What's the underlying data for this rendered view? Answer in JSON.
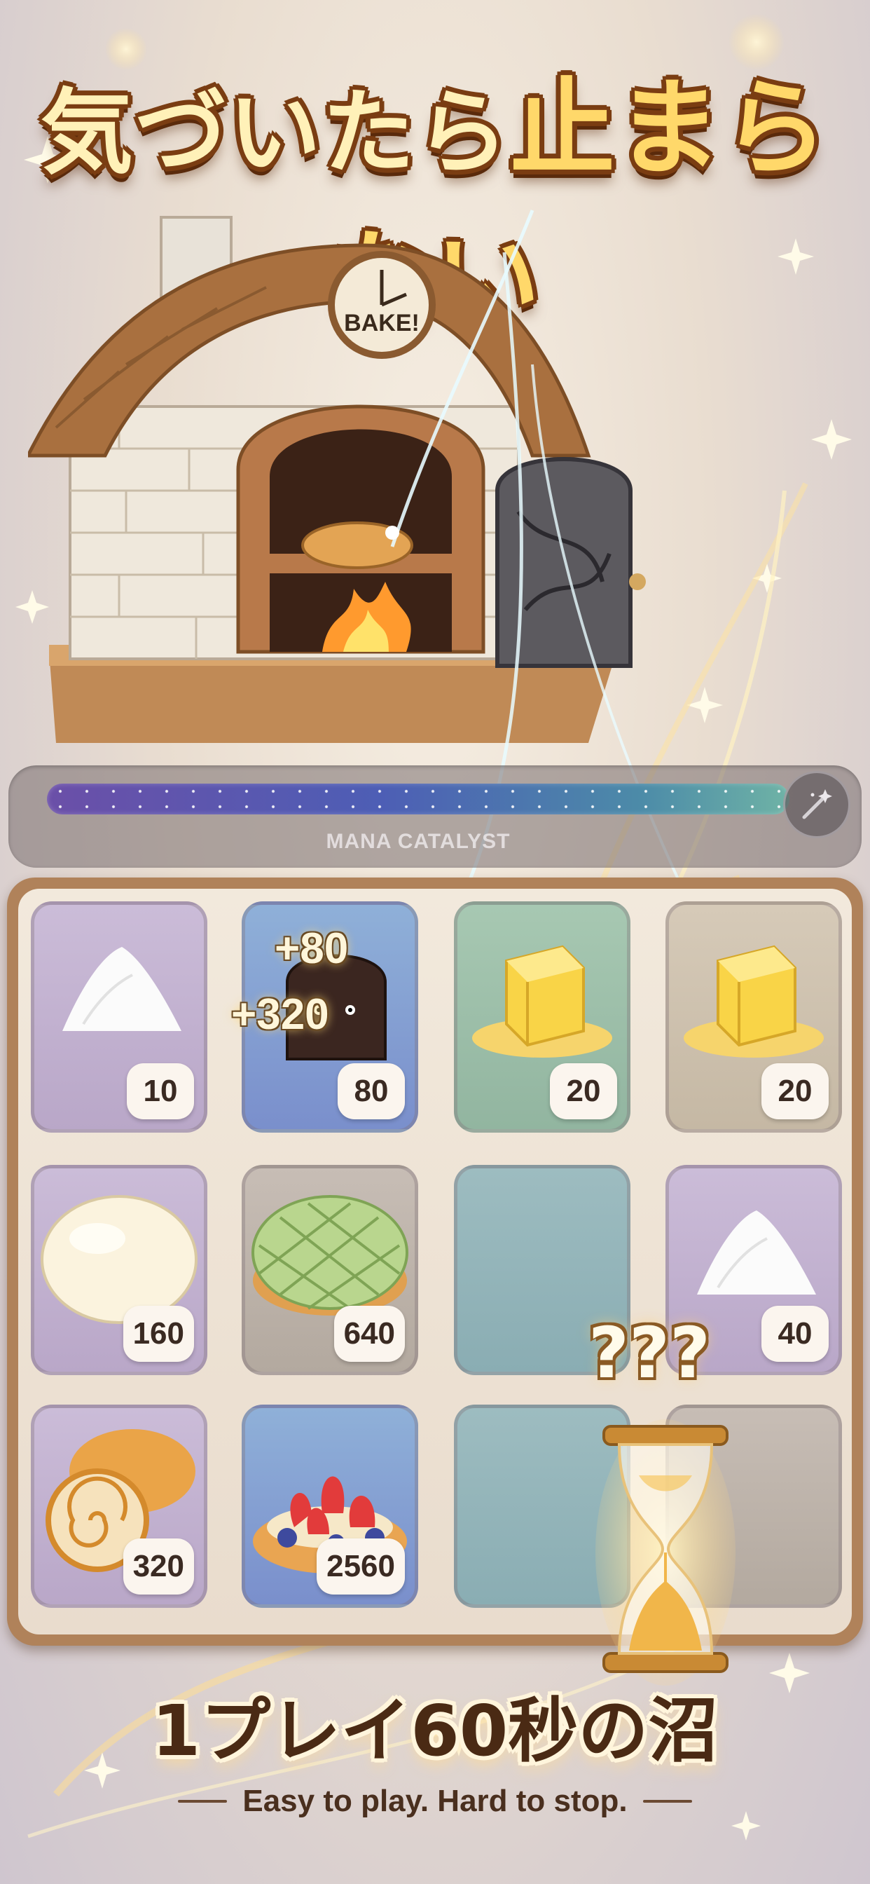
{
  "headline": {
    "part1": "気づいたら",
    "part2": "止まらない"
  },
  "oven": {
    "sign": "BAKE!"
  },
  "mana": {
    "label": "MANA CATALYST",
    "level": 0.9,
    "wand_icon": "magic-wand-icon"
  },
  "board": {
    "tiles": [
      {
        "item": "flour",
        "value": "10",
        "color": "purple"
      },
      {
        "item": "burnt-toast",
        "value": "80",
        "color": "blue"
      },
      {
        "item": "butter",
        "value": "20",
        "color": "green"
      },
      {
        "item": "butter",
        "value": "20",
        "color": "tan"
      },
      {
        "item": "dough-ball",
        "value": "160",
        "color": "purple"
      },
      {
        "item": "melon-pan",
        "value": "640",
        "color": "gray"
      },
      {
        "item": "empty",
        "value": "",
        "color": "teal"
      },
      {
        "item": "flour",
        "value": "40",
        "color": "purple"
      },
      {
        "item": "butter-roll",
        "value": "320",
        "color": "purple"
      },
      {
        "item": "berry-danish",
        "value": "2560",
        "color": "blue"
      },
      {
        "item": "empty",
        "value": "",
        "color": "teal"
      },
      {
        "item": "empty",
        "value": "",
        "color": "gray"
      }
    ]
  },
  "effects": {
    "plus_small": "+80",
    "plus_big": "+320",
    "mystery": "???"
  },
  "tagline": {
    "jp": "1プレイ60秒の沼",
    "en": "Easy to play. Hard to stop."
  },
  "colors": {
    "title_fill": "#fff1b8",
    "title_outline": "#7a3d12",
    "board_frame": "#b0825a"
  }
}
